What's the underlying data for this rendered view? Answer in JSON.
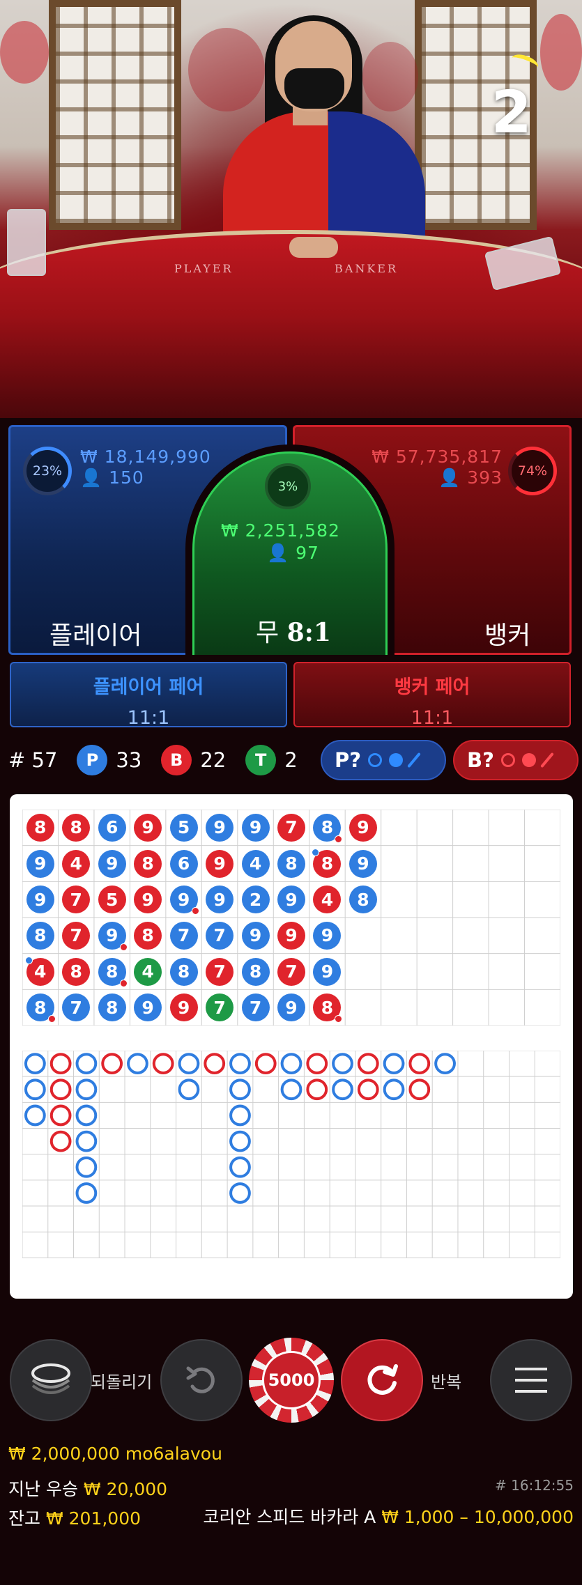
{
  "video": {
    "round_count": "2",
    "felt_player": "PLAYER",
    "felt_banker": "BANKER"
  },
  "player": {
    "percent": "23%",
    "amount": "₩ 18,149,990",
    "players": "150",
    "label": "플레이어"
  },
  "banker": {
    "percent": "74%",
    "amount": "₩ 57,735,817",
    "players": "393",
    "label": "뱅커"
  },
  "tie": {
    "percent": "3%",
    "amount": "₩ 2,251,582",
    "players": "97",
    "label": "무",
    "odds": "8:1"
  },
  "player_pair": {
    "label": "플레이어 페어",
    "odds": "11:1"
  },
  "banker_pair": {
    "label": "뱅커 페어",
    "odds": "11:1"
  },
  "stats": {
    "rounds": "# 57",
    "p_letter": "P",
    "p_count": "33",
    "b_letter": "B",
    "b_count": "22",
    "t_letter": "T",
    "t_count": "2"
  },
  "predict": {
    "player_label": "P?",
    "banker_label": "B?"
  },
  "colors": {
    "player": "#2f7de0",
    "banker": "#e0242c",
    "tie": "#1e9a46",
    "gold": "#ffd21a"
  },
  "bead_road": {
    "columns": [
      [
        {
          "n": "8",
          "c": "B"
        },
        {
          "n": "9",
          "c": "P"
        },
        {
          "n": "9",
          "c": "P"
        },
        {
          "n": "8",
          "c": "P"
        },
        {
          "n": "4",
          "c": "B",
          "pd": "P"
        },
        {
          "n": "8",
          "c": "P",
          "pd": "B"
        }
      ],
      [
        {
          "n": "8",
          "c": "B"
        },
        {
          "n": "4",
          "c": "B"
        },
        {
          "n": "7",
          "c": "B"
        },
        {
          "n": "7",
          "c": "B"
        },
        {
          "n": "8",
          "c": "B"
        },
        {
          "n": "7",
          "c": "P"
        }
      ],
      [
        {
          "n": "6",
          "c": "P"
        },
        {
          "n": "9",
          "c": "P"
        },
        {
          "n": "5",
          "c": "B"
        },
        {
          "n": "9",
          "c": "P",
          "pd": "B"
        },
        {
          "n": "8",
          "c": "P",
          "pd": "B"
        },
        {
          "n": "8",
          "c": "P"
        }
      ],
      [
        {
          "n": "9",
          "c": "B"
        },
        {
          "n": "8",
          "c": "B"
        },
        {
          "n": "9",
          "c": "B"
        },
        {
          "n": "8",
          "c": "B"
        },
        {
          "n": "4",
          "c": "T"
        },
        {
          "n": "9",
          "c": "P"
        }
      ],
      [
        {
          "n": "5",
          "c": "P"
        },
        {
          "n": "6",
          "c": "P"
        },
        {
          "n": "9",
          "c": "P",
          "pd": "B"
        },
        {
          "n": "7",
          "c": "P"
        },
        {
          "n": "8",
          "c": "P"
        },
        {
          "n": "9",
          "c": "B"
        }
      ],
      [
        {
          "n": "9",
          "c": "P"
        },
        {
          "n": "9",
          "c": "B"
        },
        {
          "n": "9",
          "c": "P"
        },
        {
          "n": "7",
          "c": "P"
        },
        {
          "n": "7",
          "c": "B"
        },
        {
          "n": "7",
          "c": "T"
        }
      ],
      [
        {
          "n": "9",
          "c": "P"
        },
        {
          "n": "4",
          "c": "P"
        },
        {
          "n": "2",
          "c": "P"
        },
        {
          "n": "9",
          "c": "P"
        },
        {
          "n": "8",
          "c": "P"
        },
        {
          "n": "7",
          "c": "P"
        }
      ],
      [
        {
          "n": "7",
          "c": "B"
        },
        {
          "n": "8",
          "c": "P"
        },
        {
          "n": "9",
          "c": "P"
        },
        {
          "n": "9",
          "c": "B"
        },
        {
          "n": "7",
          "c": "B"
        },
        {
          "n": "9",
          "c": "P"
        }
      ],
      [
        {
          "n": "8",
          "c": "P",
          "pd": "B"
        },
        {
          "n": "8",
          "c": "B",
          "pd": "P"
        },
        {
          "n": "4",
          "c": "B"
        },
        {
          "n": "9",
          "c": "P"
        },
        {
          "n": "9",
          "c": "P"
        },
        {
          "n": "8",
          "c": "B",
          "pd": "B"
        }
      ],
      [
        {
          "n": "9",
          "c": "B"
        },
        {
          "n": "9",
          "c": "P"
        },
        {
          "n": "8",
          "c": "P"
        }
      ]
    ]
  },
  "big_road": {
    "columns": [
      [
        "P",
        "P",
        "P"
      ],
      [
        "B",
        "B",
        "B",
        "B"
      ],
      [
        "P",
        "P",
        "P",
        "P",
        "P",
        "P"
      ],
      [
        "B"
      ],
      [
        "P"
      ],
      [
        "B"
      ],
      [
        "P",
        "P"
      ],
      [
        "B"
      ],
      [
        "P",
        "P",
        "P",
        "P",
        "P",
        "P"
      ],
      [
        "B"
      ],
      [
        "P",
        "P"
      ],
      [
        "B",
        "B"
      ],
      [
        "P",
        "P"
      ],
      [
        "B",
        "B"
      ],
      [
        "P",
        "P"
      ],
      [
        "B",
        "B"
      ],
      [
        "P"
      ]
    ]
  },
  "controls": {
    "undo_label": "되돌리기",
    "chip_value": "5000",
    "repeat_label": "반복"
  },
  "footer": {
    "balance_user": "₩ 2,000,000 mo6alavou",
    "last_win_label": "지난 우승",
    "last_win_value": "₩ 20,000",
    "game_id": "# 16:12:55",
    "balance_label": "잔고",
    "balance_value": "₩ 201,000",
    "table_name": "코리안 스피드 바카라 A",
    "limits": "₩ 1,000 – 10,000,000"
  }
}
